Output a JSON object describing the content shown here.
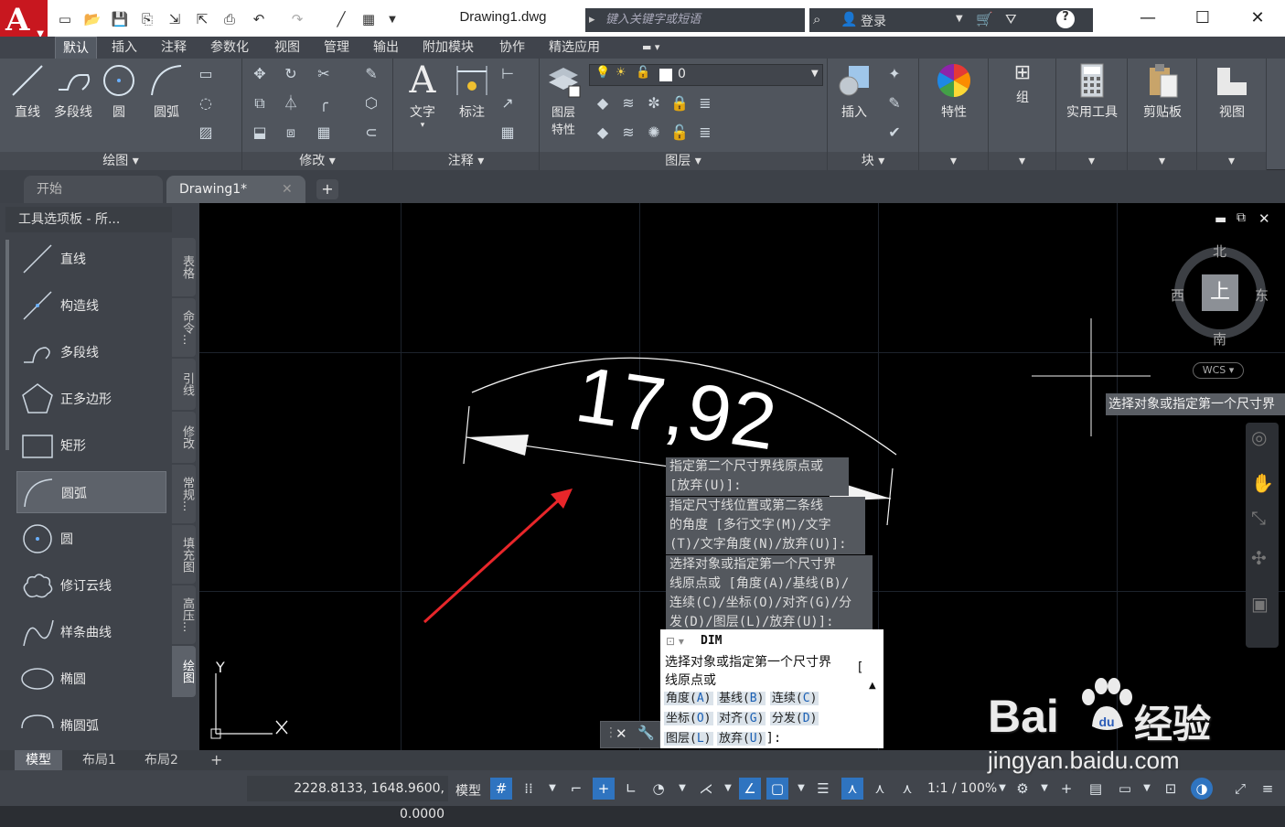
{
  "title_bar": {
    "doc_title": "Drawing1.dwg",
    "search_placeholder": "键入关键字或短语",
    "login_label": "登录"
  },
  "ribbon_tabs": [
    "默认",
    "插入",
    "注释",
    "参数化",
    "视图",
    "管理",
    "输出",
    "附加模块",
    "协作",
    "精选应用"
  ],
  "ribbon": {
    "draw_panel": {
      "title": "绘图",
      "buttons": [
        "直线",
        "多段线",
        "圆",
        "圆弧"
      ]
    },
    "modify_panel": {
      "title": "修改"
    },
    "annotation_panel": {
      "title": "注释",
      "buttons": [
        "文字",
        "标注"
      ]
    },
    "layer_panel": {
      "title": "图层",
      "layer_props_line1": "图层",
      "layer_props_line2": "特性",
      "current_layer": "0"
    },
    "block_panel": {
      "title": "块",
      "insert_label": "插入"
    },
    "properties_label": "特性",
    "group_label": "组",
    "utilities_label": "实用工具",
    "clipboard_label": "剪贴板",
    "view_label": "视图"
  },
  "file_tabs": {
    "start": "开始",
    "drawing": "Drawing1*"
  },
  "palette": {
    "title": "工具选项板 - 所...",
    "items": [
      "直线",
      "构造线",
      "多段线",
      "正多边形",
      "矩形",
      "圆弧",
      "圆",
      "修订云线",
      "样条曲线",
      "椭圆",
      "椭圆弧"
    ],
    "side_tabs": [
      "表格",
      "命令...",
      "引线",
      "修改",
      "常规...",
      "填充图",
      "高压...",
      "绘图"
    ]
  },
  "viewcube": {
    "north": "北",
    "south": "南",
    "east": "东",
    "west": "西",
    "top": "上",
    "wcs": "WCS"
  },
  "drawing": {
    "dimension_text": "17,92",
    "ucs_y": "Y",
    "cursor_tip": "选择对象或指定第一个尺寸界"
  },
  "command_history": [
    "指定第二个尺寸界线原点或\n[放弃(U)]:",
    "指定尺寸线位置或第二条线\n的角度 [多行文字(M)/文字\n(T)/文字角度(N)/放弃(U)]:",
    "选择对象或指定第一个尺寸界\n线原点或 [角度(A)/基线(B)/\n连续(C)/坐标(O)/对齐(G)/分\n发(D)/图层(L)/放弃(U)]:"
  ],
  "command_line": {
    "command": "DIM",
    "prompt_line1": "选择对象或指定第一个尺寸界",
    "prompt_line2": "线原点或",
    "bracket": "[",
    "options": [
      {
        "label": "角度",
        "key": "A"
      },
      {
        "label": "基线",
        "key": "B"
      },
      {
        "label": "连续",
        "key": "C"
      },
      {
        "label": "坐标",
        "key": "O"
      },
      {
        "label": "对齐",
        "key": "G"
      },
      {
        "label": "分发",
        "key": "D"
      },
      {
        "label": "图层",
        "key": "L"
      },
      {
        "label": "放弃",
        "key": "U"
      }
    ],
    "tail": "]:"
  },
  "layout_tabs": [
    "模型",
    "布局1",
    "布局2"
  ],
  "status_bar": {
    "coordinates": "2228.8133, 1648.9600, 0.0000",
    "model_label": "模型",
    "scale": "1:1 / 100%"
  },
  "watermark": {
    "brand": "Bai",
    "suffix": "经验",
    "url": "jingyan.baidu.com"
  },
  "colors": {
    "accent_red": "#c8171f",
    "arrow_red": "#e8262a",
    "status_active": "#2f74c0"
  }
}
